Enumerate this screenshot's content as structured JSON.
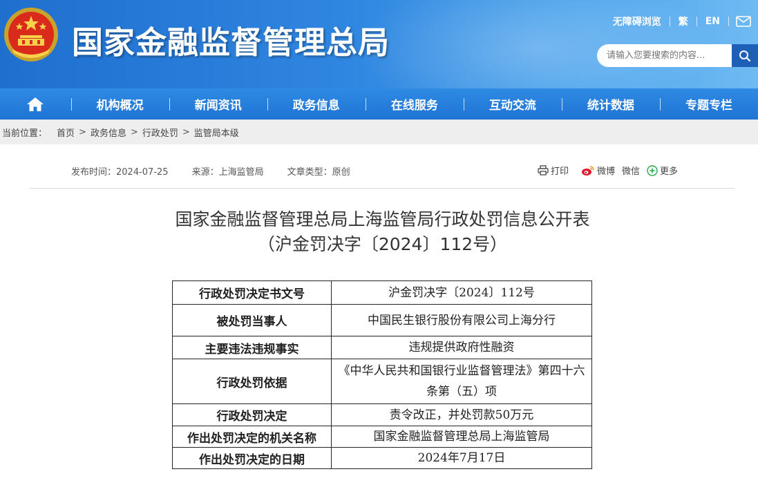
{
  "header": {
    "site_title": "国家金融监督管理总局",
    "links": {
      "accessibility": "无障碍浏览",
      "traditional": "繁",
      "english": "EN"
    },
    "search": {
      "placeholder": "请输入您要搜索的内容..."
    }
  },
  "nav": {
    "items": [
      {
        "label": "机构概况"
      },
      {
        "label": "新闻资讯"
      },
      {
        "label": "政务信息"
      },
      {
        "label": "在线服务"
      },
      {
        "label": "互动交流"
      },
      {
        "label": "统计数据"
      },
      {
        "label": "专题专栏"
      }
    ]
  },
  "breadcrumb": {
    "label": "当前位置：",
    "items": [
      "首页",
      "政务信息",
      "行政处罚",
      "监管局本级"
    ]
  },
  "article": {
    "publish_time": "发布时间：2024-07-25",
    "source": "来源：上海监管局",
    "type": "文章类型：原创",
    "title_line1": "国家金融监督管理总局上海监管局行政处罚信息公开表",
    "title_line2": "（沪金罚决字〔2024〕112号）"
  },
  "share": {
    "print": "打印",
    "weibo": "微博",
    "wechat": "微信",
    "more": "更多"
  },
  "penalty_table": {
    "rows": [
      {
        "key": "行政处罚决定书文号",
        "value": "沪金罚决字〔2024〕112号"
      },
      {
        "key": "被处罚当事人",
        "value": "中国民生银行股份有限公司上海分行"
      },
      {
        "key": "主要违法违规事实",
        "value": "违规提供政府性融资"
      },
      {
        "key": "行政处罚依据",
        "value": "《中华人民共和国银行业监督管理法》第四十六条第（五）项"
      },
      {
        "key": "行政处罚决定",
        "value": "责令改正，并处罚款50万元"
      },
      {
        "key": "作出处罚决定的机关名称",
        "value": "国家金融监督管理总局上海监管局"
      },
      {
        "key": "作出处罚决定的日期",
        "value": "2024年7月17日"
      }
    ]
  },
  "colors": {
    "header_blue": "#2f86e0",
    "nav_blue": "#1f74d4",
    "title_text": "#ffffff"
  }
}
